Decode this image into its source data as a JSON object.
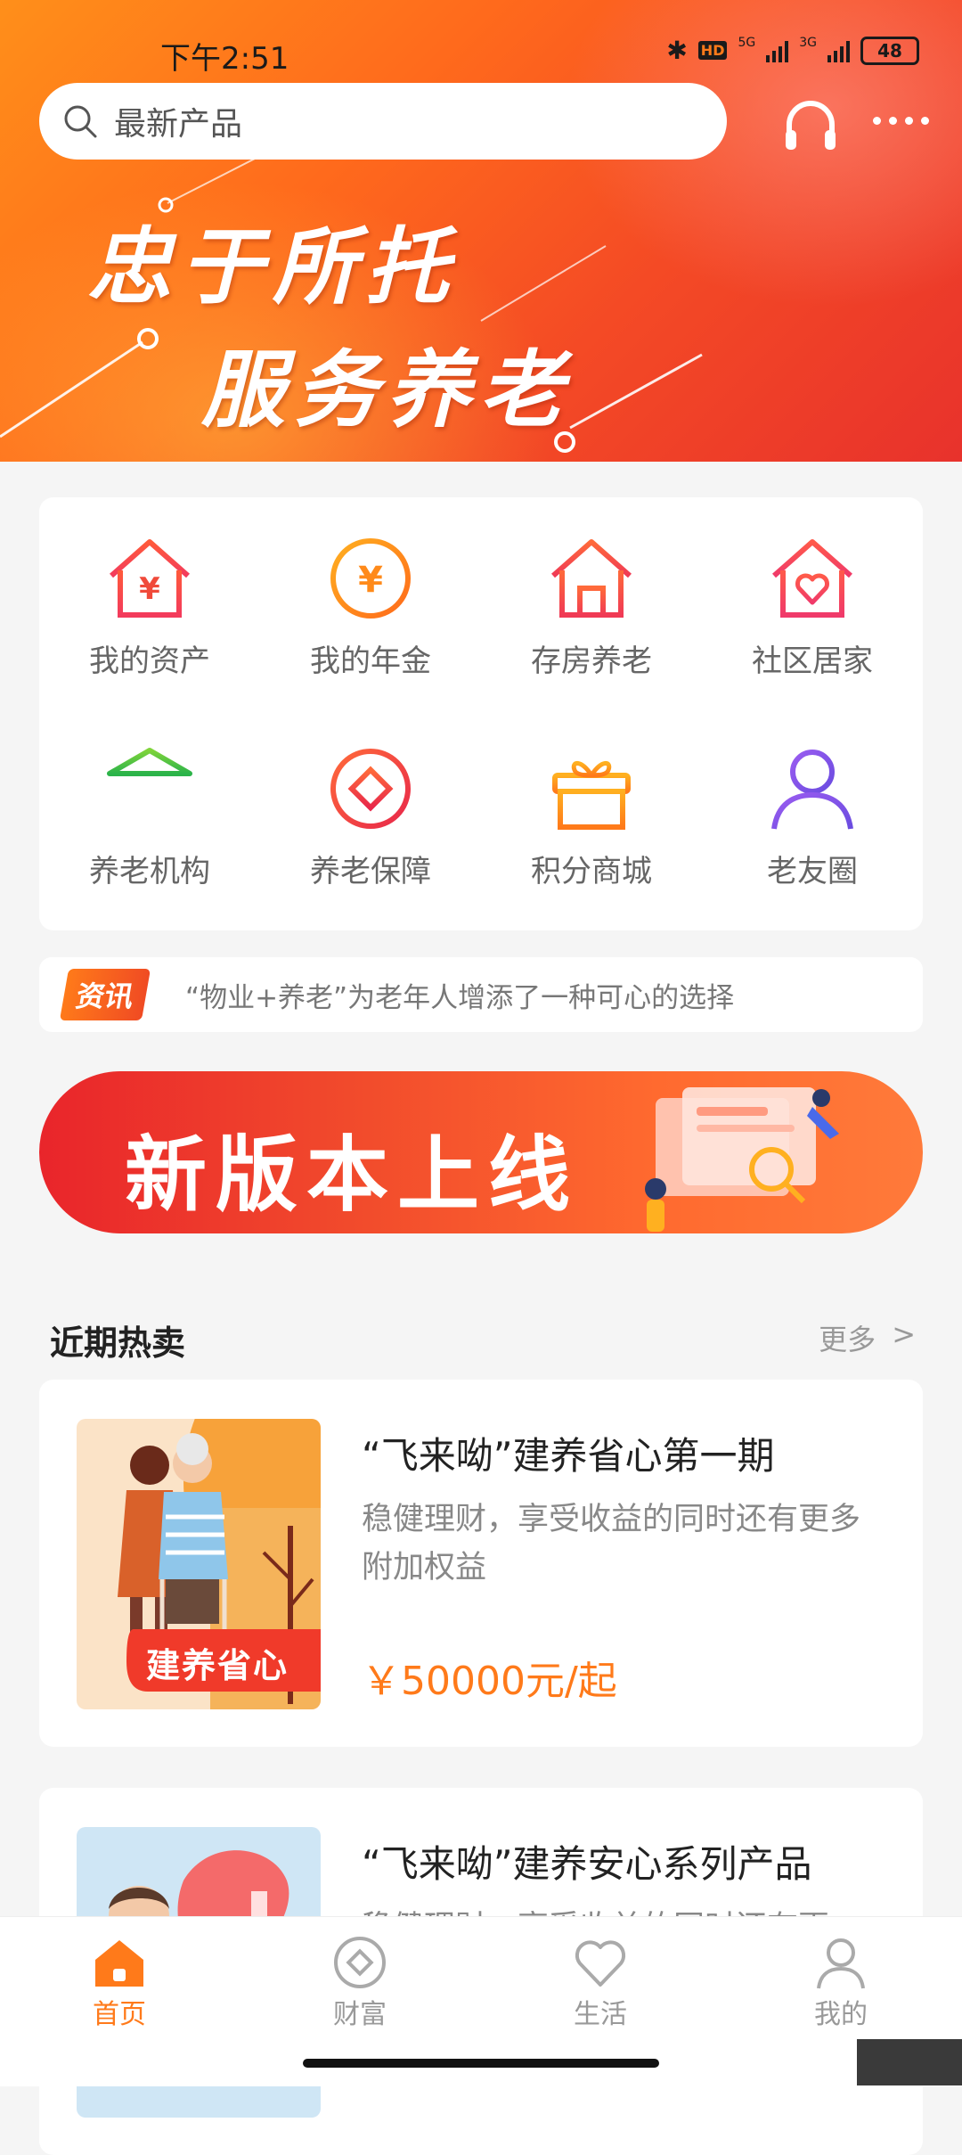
{
  "status_bar": {
    "time": "下午2:51",
    "battery": "48",
    "net1": "5G",
    "net2": "3G",
    "hd": "HD"
  },
  "search": {
    "placeholder": "最新产品"
  },
  "hero": {
    "line1": "忠于所托",
    "line2": "服务养老"
  },
  "shortcuts": [
    {
      "label": "我的资产",
      "icon": "house-yen-icon"
    },
    {
      "label": "我的年金",
      "icon": "yen-coin-icon"
    },
    {
      "label": "存房养老",
      "icon": "house-icon"
    },
    {
      "label": "社区居家",
      "icon": "house-heart-icon"
    },
    {
      "label": "养老机构",
      "icon": "institution-icon"
    },
    {
      "label": "养老保障",
      "icon": "diamond-circle-icon"
    },
    {
      "label": "积分商城",
      "icon": "gift-icon"
    },
    {
      "label": "老友圈",
      "icon": "person-icon"
    }
  ],
  "news": {
    "tag": "资讯",
    "headline": "“物业+养老”为老年人增添了一种可心的选择"
  },
  "promo_banner": {
    "text": "新版本上线"
  },
  "hot": {
    "title": "近期热卖",
    "more": "更多",
    "more_arrow": ">"
  },
  "products": [
    {
      "title": "“飞来呦”建养省心第一期",
      "desc": "稳健理财，享受收益的同时还有更多附加权益",
      "price": "￥50000元/起",
      "image_label": "建养省心"
    },
    {
      "title": "“飞来呦”建养安心系列产品",
      "desc": "稳健理财，享受收益的同时还有更",
      "price": "",
      "image_label": ""
    }
  ],
  "tabs": [
    {
      "label": "首页",
      "icon": "home-icon",
      "active": true
    },
    {
      "label": "财富",
      "icon": "wealth-icon",
      "active": false
    },
    {
      "label": "生活",
      "icon": "heart-icon",
      "active": false
    },
    {
      "label": "我的",
      "icon": "user-icon",
      "active": false
    }
  ],
  "colors": {
    "accent": "#ff7a1a",
    "hero_red": "#e8322c",
    "hero_orange": "#ff8f1a"
  }
}
